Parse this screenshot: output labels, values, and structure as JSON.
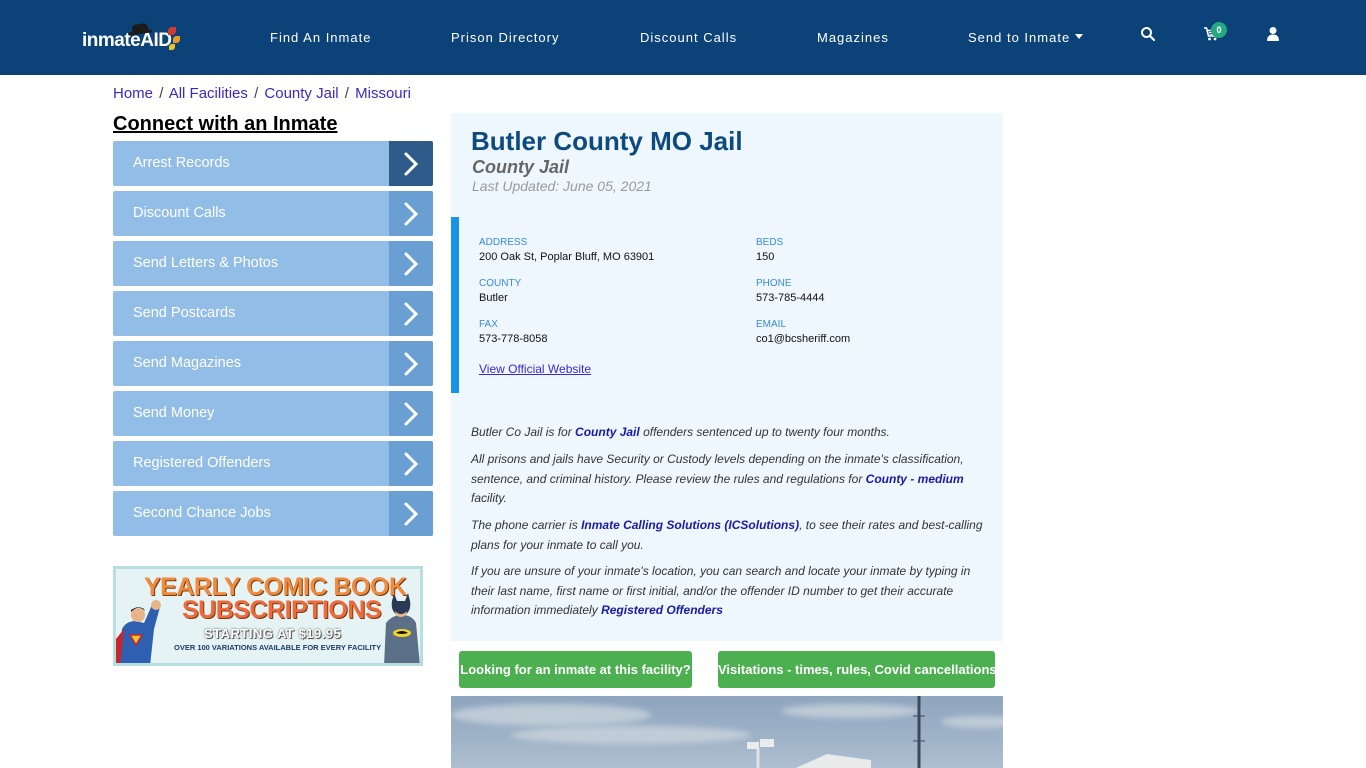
{
  "header": {
    "logo_text": "inmateAID",
    "nav": [
      {
        "label": "Find An Inmate",
        "has_dropdown": false
      },
      {
        "label": "Prison Directory",
        "has_dropdown": false
      },
      {
        "label": "Discount Calls",
        "has_dropdown": false
      },
      {
        "label": "Magazines",
        "has_dropdown": false
      },
      {
        "label": "Send to Inmate",
        "has_dropdown": true
      }
    ],
    "icons": [
      "search-icon",
      "cart-icon",
      "user-icon"
    ],
    "cart_count": "0",
    "colors": {
      "background": "#0b4278",
      "badge": "#24a982"
    }
  },
  "breadcrumb": [
    {
      "label": "Home"
    },
    {
      "label": "All Facilities"
    },
    {
      "label": "County Jail"
    },
    {
      "label": "Missouri"
    }
  ],
  "breadcrumb_separator": "/",
  "sidebar": {
    "title": "Connect with an Inmate",
    "items": [
      {
        "label": "Arrest Records",
        "active": true
      },
      {
        "label": "Discount Calls",
        "active": false
      },
      {
        "label": "Send Letters & Photos",
        "active": false
      },
      {
        "label": "Send Postcards",
        "active": false
      },
      {
        "label": "Send Magazines",
        "active": false
      },
      {
        "label": "Send Money",
        "active": false
      },
      {
        "label": "Registered Offenders",
        "active": false
      },
      {
        "label": "Second Chance Jobs",
        "active": false
      }
    ],
    "ad": {
      "line1": "YEARLY COMIC BOOK",
      "line2": "SUBSCRIPTIONS",
      "line3": "STARTING AT $19.95",
      "line4": "OVER 100 VARIATIONS AVAILABLE FOR EVERY FACILITY"
    }
  },
  "facility": {
    "name": "Butler County MO Jail",
    "type": "County Jail",
    "last_updated": "Last Updated: June 05, 2021",
    "details": {
      "address": {
        "label": "ADDRESS",
        "value": "200 Oak St, Poplar Bluff, MO 63901"
      },
      "beds": {
        "label": "BEDS",
        "value": "150"
      },
      "county": {
        "label": "COUNTY",
        "value": "Butler"
      },
      "phone": {
        "label": "PHONE",
        "value": "573-785-4444"
      },
      "fax": {
        "label": "FAX",
        "value": "573-778-8058"
      },
      "email": {
        "label": "EMAIL",
        "value": "co1@bcsheriff.com"
      }
    },
    "website_link": "View Official Website"
  },
  "description": {
    "p1": {
      "pre": "Butler Co Jail is for ",
      "link": "County Jail",
      "post": " offenders sentenced up to twenty four months."
    },
    "p2": {
      "pre": "All prisons and jails have Security or Custody levels depending on the inmate's classification, sentence, and criminal history. Please review the rules and regulations for ",
      "link": "County - medium",
      "post": " facility."
    },
    "p3": {
      "pre": "The phone carrier is ",
      "link": "Inmate Calling Solutions (ICSolutions)",
      "post": ", to see their rates and best-calling plans for your inmate to call you."
    },
    "p4": {
      "pre": "If you are unsure of your inmate's location, you can search and locate your inmate by typing in their last name, first name or first initial, and/or the offender ID number to get their accurate information immediately ",
      "link": "Registered Offenders",
      "post": ""
    }
  },
  "actions": {
    "find_inmate": "Looking for an inmate at this facility?",
    "visitations": "Visitations - times, rules, Covid cancellations"
  }
}
